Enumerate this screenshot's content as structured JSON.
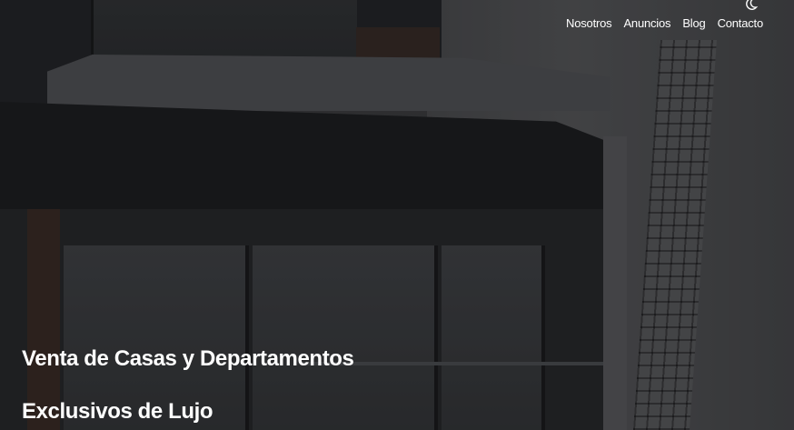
{
  "nav": {
    "items": [
      {
        "label": "Nosotros"
      },
      {
        "label": "Anuncios"
      },
      {
        "label": "Blog"
      },
      {
        "label": "Contacto"
      }
    ],
    "theme_toggle_icon": "moon-icon"
  },
  "hero": {
    "title_line1": "Venta de Casas y Departamentos",
    "title_line2": "Exclusivos de Lujo",
    "background": "dark-building-photo"
  },
  "colors": {
    "text": "#ffffff",
    "overlay": "#000000"
  }
}
